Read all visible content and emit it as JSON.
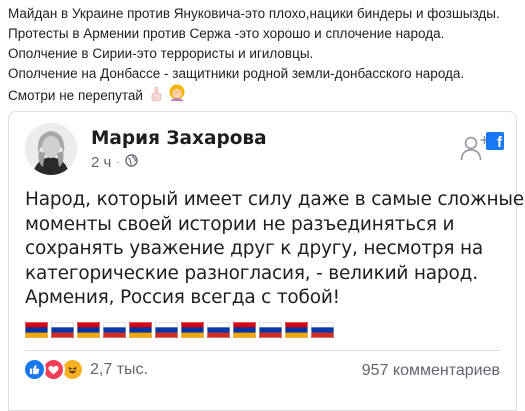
{
  "post": {
    "lines": [
      "Майдан в Украине против Януковича-это плохо,нацики биндеры и фозшызды.",
      "Протесты в Армении против Сержа -это хорошо и сплочение народа.",
      "Ополчение в Сирии-это террористы и игиловцы.",
      "Ополчение на Донбассе - защитники родной земли-донбасского народа.",
      "Смотри не перепутай"
    ],
    "emojis": [
      "pointing-finger-icon",
      "facepalm-woman-icon"
    ]
  },
  "shared": {
    "author": "Мария Захарова",
    "time": "2 ч",
    "separator": "·",
    "visibility_icon": "globe-icon",
    "quote_lines": [
      "Народ, который имеет силу даже в самые сложные",
      "моменты своей истории не разъединяться и",
      "сохранять уважение друг к другу, несмотря на",
      "категорические разногласия, - великий народ.",
      "Армения, Россия всегда с тобой!"
    ],
    "flags": [
      "armenia",
      "russia",
      "armenia",
      "russia",
      "armenia",
      "russia",
      "armenia",
      "russia",
      "armenia",
      "russia",
      "armenia",
      "russia"
    ],
    "reactions": [
      "like-icon",
      "love-icon",
      "haha-icon"
    ],
    "reaction_count": "2,7 тыс.",
    "comments": "957 комментариев"
  },
  "colors": {
    "facebook_blue": "#1877f2",
    "armenia": [
      "#d90012",
      "#0033a0",
      "#f2a800"
    ],
    "russia": [
      "#ffffff",
      "#0039a6",
      "#d52b1e"
    ]
  }
}
